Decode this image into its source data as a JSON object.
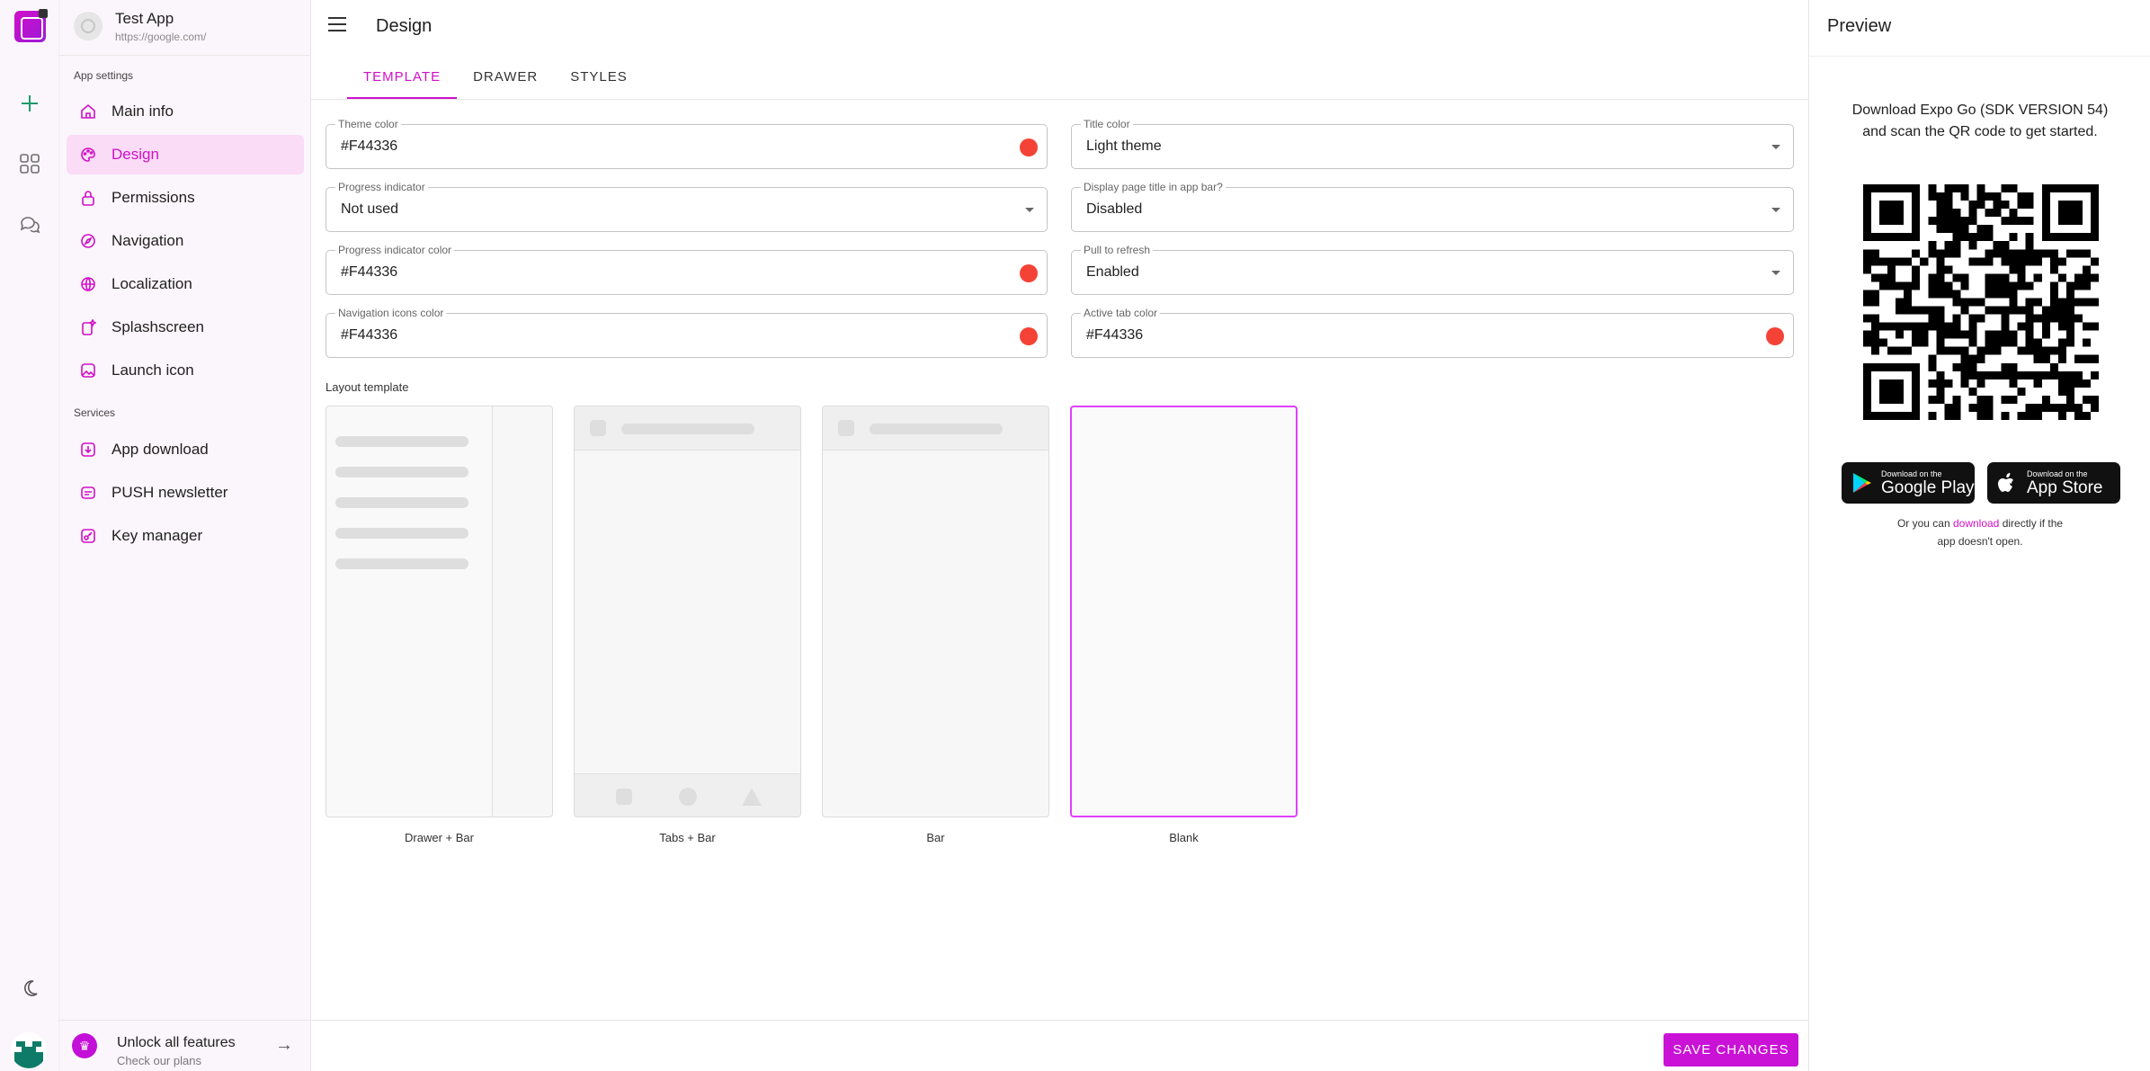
{
  "colors": {
    "accent": "#d10fc9",
    "theme_dot": "#F44336",
    "selected_border": "#e040fb"
  },
  "sidebar": {
    "app_title": "Test App",
    "app_url": "https://google.com/",
    "section_app": "App settings",
    "section_services": "Services",
    "items": [
      {
        "label": "Main info",
        "icon": "home-icon"
      },
      {
        "label": "Design",
        "icon": "palette-icon",
        "active": true
      },
      {
        "label": "Permissions",
        "icon": "lock-icon"
      },
      {
        "label": "Navigation",
        "icon": "compass-icon"
      },
      {
        "label": "Localization",
        "icon": "globe-icon"
      },
      {
        "label": "Splashscreen",
        "icon": "sparkle-icon"
      },
      {
        "label": "Launch icon",
        "icon": "image-icon"
      }
    ],
    "services": [
      {
        "label": "App download",
        "icon": "download-icon"
      },
      {
        "label": "PUSH newsletter",
        "icon": "bell-icon"
      },
      {
        "label": "Key manager",
        "icon": "key-icon"
      }
    ],
    "unlock_title": "Unlock all features",
    "unlock_sub": "Check our plans"
  },
  "main": {
    "title": "Design",
    "tabs": [
      "TEMPLATE",
      "DRAWER",
      "STYLES"
    ],
    "fields": {
      "theme_color": {
        "label": "Theme color",
        "value": "#F44336"
      },
      "title_color": {
        "label": "Title color",
        "value": "Light theme"
      },
      "progress_indicator": {
        "label": "Progress indicator",
        "value": "Not used"
      },
      "display_title": {
        "label": "Display page title in app bar?",
        "value": "Disabled"
      },
      "progress_color": {
        "label": "Progress indicator color",
        "value": "#F44336"
      },
      "pull_refresh": {
        "label": "Pull to refresh",
        "value": "Enabled"
      },
      "nav_icons_color": {
        "label": "Navigation icons color",
        "value": "#F44336"
      },
      "active_tab_color": {
        "label": "Active tab color",
        "value": "#F44336"
      }
    },
    "layout_label": "Layout template",
    "templates": [
      "Drawer + Bar",
      "Tabs + Bar",
      "Bar",
      "Blank"
    ],
    "selected_template": "Blank",
    "save_label": "SAVE CHANGES"
  },
  "preview": {
    "title": "Preview",
    "expo_line1": "Download Expo Go (SDK VERSION 54)",
    "expo_line2": "and scan the QR code to get started.",
    "google_top": "Download on the",
    "google_big": "Google Play",
    "apple_top": "Download on the",
    "apple_big": "App Store",
    "download_pre": "Or you can",
    "download_link": "download",
    "download_post": "directly if the",
    "download_line2": "app doesn't open."
  }
}
